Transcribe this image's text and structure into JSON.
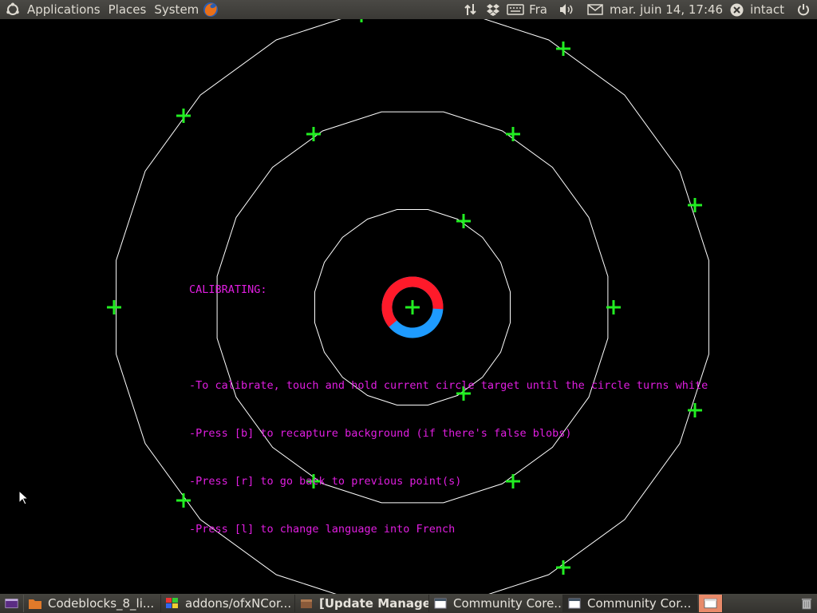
{
  "top_panel": {
    "menus": [
      "Applications",
      "Places",
      "System"
    ],
    "keyboard_layout": "Fra",
    "datetime": "mar. juin 14, 17:46",
    "user": "intact"
  },
  "calibration": {
    "title": "CALIBRATING:",
    "instructions": [
      "-To calibrate, touch and hold current circle target until the circle turns white",
      "-Press [b] to recapture background (if there's false blobs)",
      "-Press [r] to go back to previous point(s)",
      "-Press [l] to change language into French"
    ],
    "colors": {
      "text": "#e01ee0",
      "target_cross": "#22ee22",
      "ring_line": "#ffffff",
      "progress_red": "#ff1a2a",
      "progress_blue": "#1e9bff"
    },
    "progress": 0.62
  },
  "taskbar": {
    "tasks": [
      {
        "label": "Codeblocks_8_li...",
        "icon": "folder-icon",
        "bold": false
      },
      {
        "label": "addons/ofxNCor...",
        "icon": "window-icon",
        "bold": false
      },
      {
        "label": "[Update Manager]",
        "icon": "package-icon",
        "bold": true
      },
      {
        "label": "Community Core...",
        "icon": "window-icon",
        "bold": false
      },
      {
        "label": "Community Cor...",
        "icon": "window-icon",
        "bold": false
      }
    ]
  }
}
